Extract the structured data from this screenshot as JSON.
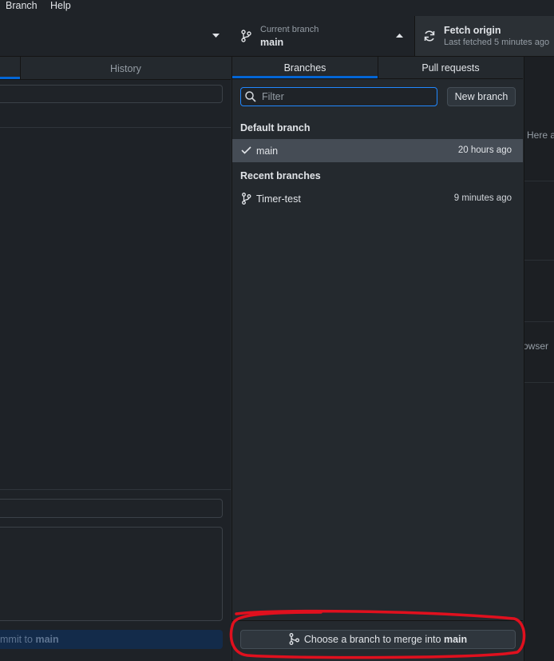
{
  "menubar": {
    "items": [
      "Branch",
      "Help"
    ]
  },
  "toolbar": {
    "current_branch": {
      "caption": "Current branch",
      "name": "main"
    },
    "fetch": {
      "title": "Fetch origin",
      "subtitle": "Last fetched 5 minutes ago"
    }
  },
  "left_pane": {
    "tabs": [
      "History"
    ],
    "commit_button": {
      "label_prefix": "mmit to ",
      "label_branch": "main"
    }
  },
  "popup": {
    "tabs": [
      "Branches",
      "Pull requests"
    ],
    "filter": {
      "placeholder": "Filter",
      "value": ""
    },
    "new_branch_label": "New branch",
    "default_section": "Default branch",
    "default_branch": {
      "name": "main",
      "time": "20 hours ago",
      "selected": true
    },
    "recent_section": "Recent branches",
    "recent_branches": [
      {
        "name": "Timer-test",
        "time": "9 minutes ago"
      }
    ],
    "merge_button": {
      "prefix": "Choose a branch to merge into ",
      "branch": "main"
    }
  },
  "background_fragments": {
    "here": "Here a",
    "browser": "owser"
  },
  "colors": {
    "accent": "#0366d6",
    "focus": "#2188ff",
    "annotation": "#e0101e"
  },
  "icons": [
    "branch-icon",
    "sync-icon",
    "caret-down-icon",
    "caret-up-icon",
    "search-icon",
    "check-icon",
    "merge-icon"
  ]
}
